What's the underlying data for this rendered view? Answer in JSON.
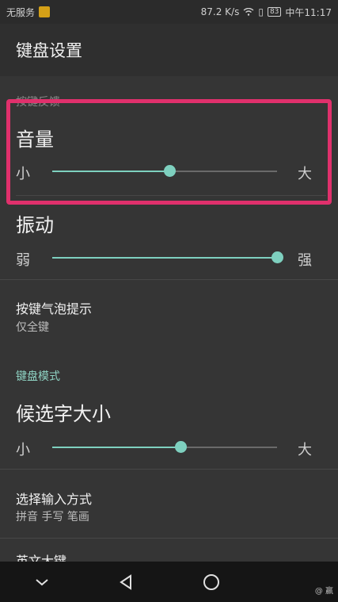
{
  "status": {
    "carrier": "无服务",
    "speed": "87.2 K/s",
    "battery": "83",
    "time": "中午11:17"
  },
  "appbar": {
    "title": "键盘设置"
  },
  "sections": {
    "key_feedback": {
      "header": "按键反馈"
    },
    "keyboard_mode": {
      "header": "键盘模式"
    }
  },
  "volume": {
    "title": "音量",
    "min_label": "小",
    "max_label": "大",
    "level": 0.52
  },
  "vibration": {
    "title": "振动",
    "min_label": "弱",
    "max_label": "强",
    "level": 1.0
  },
  "popup": {
    "title": "按键气泡提示",
    "value": "仅全键"
  },
  "candidate_size": {
    "title": "候选字大小",
    "min_label": "小",
    "max_label": "大",
    "level": 0.57
  },
  "input_method": {
    "title": "选择输入方式",
    "value": "拼音  手写  笔画"
  },
  "partial_item": {
    "title": "英文大键"
  },
  "watermark": "@ 赢",
  "colors": {
    "accent": "#7ed0bf",
    "highlight": "#e0306c"
  },
  "icons": {
    "back": "back-triangle-icon",
    "home": "home-circle-icon",
    "down": "chevron-down-icon"
  }
}
